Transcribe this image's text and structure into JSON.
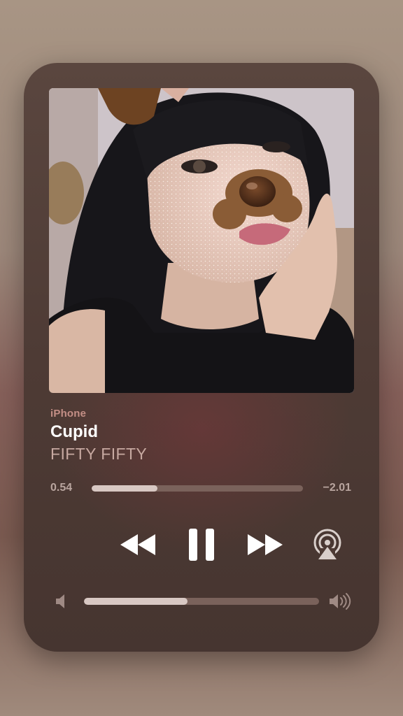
{
  "now_playing": {
    "source": "iPhone",
    "title": "Cupid",
    "artist": "FIFTY FIFTY"
  },
  "progress": {
    "elapsed": "0.54",
    "remaining": "−2.01",
    "fraction": 0.31
  },
  "controls": {
    "rewind": "rewind-icon",
    "pause": "pause-icon",
    "forward": "fast-forward-icon",
    "airplay": "airplay-icon"
  },
  "volume": {
    "fraction": 0.44,
    "low_icon": "speaker-low-icon",
    "high_icon": "speaker-high-icon"
  },
  "colors": {
    "source_label": "#c48f86",
    "title": "#ffffff",
    "artist": "#c7a9a1",
    "slider_fill": "#d8c8c3",
    "slider_track": "#7a625b"
  }
}
